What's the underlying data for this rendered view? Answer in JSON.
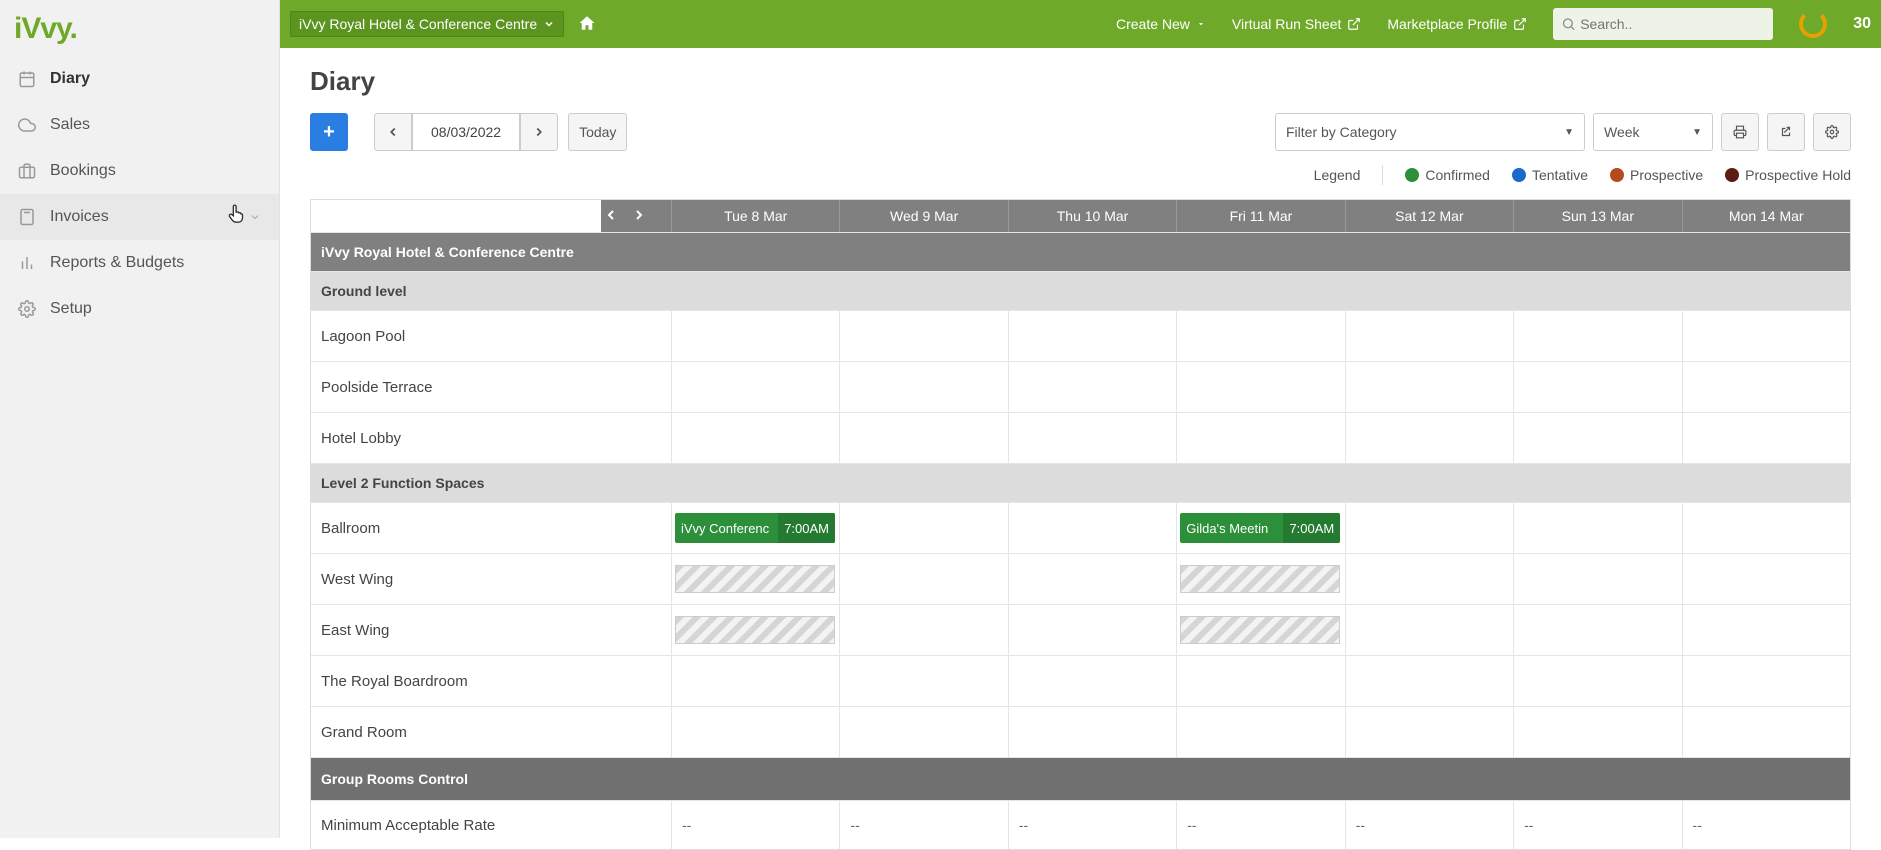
{
  "topbar": {
    "venue": "iVvy Royal Hotel & Conference Centre",
    "create": "Create New",
    "vrs": "Virtual Run Sheet",
    "marketplace": "Marketplace Profile",
    "search_placeholder": "Search..",
    "count": "30"
  },
  "logo": "iVvy.",
  "nav": {
    "diary": "Diary",
    "sales": "Sales",
    "bookings": "Bookings",
    "invoices": "Invoices",
    "reports": "Reports & Budgets",
    "setup": "Setup"
  },
  "page": {
    "title": "Diary",
    "date": "08/03/2022",
    "today": "Today",
    "filter": "Filter by Category",
    "view": "Week"
  },
  "legend": {
    "label": "Legend",
    "confirmed": "Confirmed",
    "tentative": "Tentative",
    "prospective": "Prospective",
    "prospective_hold": "Prospective Hold"
  },
  "colors": {
    "confirmed": "#2C8F3A",
    "tentative": "#1b6ac9",
    "prospective": "#b74a1a",
    "prospective_hold": "#5a1e12"
  },
  "grid": {
    "days": [
      "Tue 8 Mar",
      "Wed 9 Mar",
      "Thu 10 Mar",
      "Fri 11 Mar",
      "Sat 12 Mar",
      "Sun 13 Mar",
      "Mon 14 Mar"
    ],
    "venue_name": "iVvy Royal Hotel & Conference Centre",
    "groups": [
      {
        "name": "Ground level",
        "spaces": [
          "Lagoon Pool",
          "Poolside Terrace",
          "Hotel Lobby"
        ]
      },
      {
        "name": "Level 2 Function Spaces",
        "spaces": [
          "Ballroom",
          "West Wing",
          "East Wing",
          "The Royal Boardroom",
          "Grand Room"
        ]
      }
    ],
    "grc_header": "Group Rooms Control",
    "grc_row_label": "Minimum Acceptable Rate",
    "grc_values": [
      "--",
      "--",
      "--",
      "--",
      "--",
      "--",
      "--"
    ],
    "events": {
      "ballroom_tue": {
        "title": "iVvy Conferenc",
        "time": "7:00AM"
      },
      "ballroom_fri": {
        "title": "Gilda's Meetin",
        "time": "7:00AM"
      }
    }
  }
}
